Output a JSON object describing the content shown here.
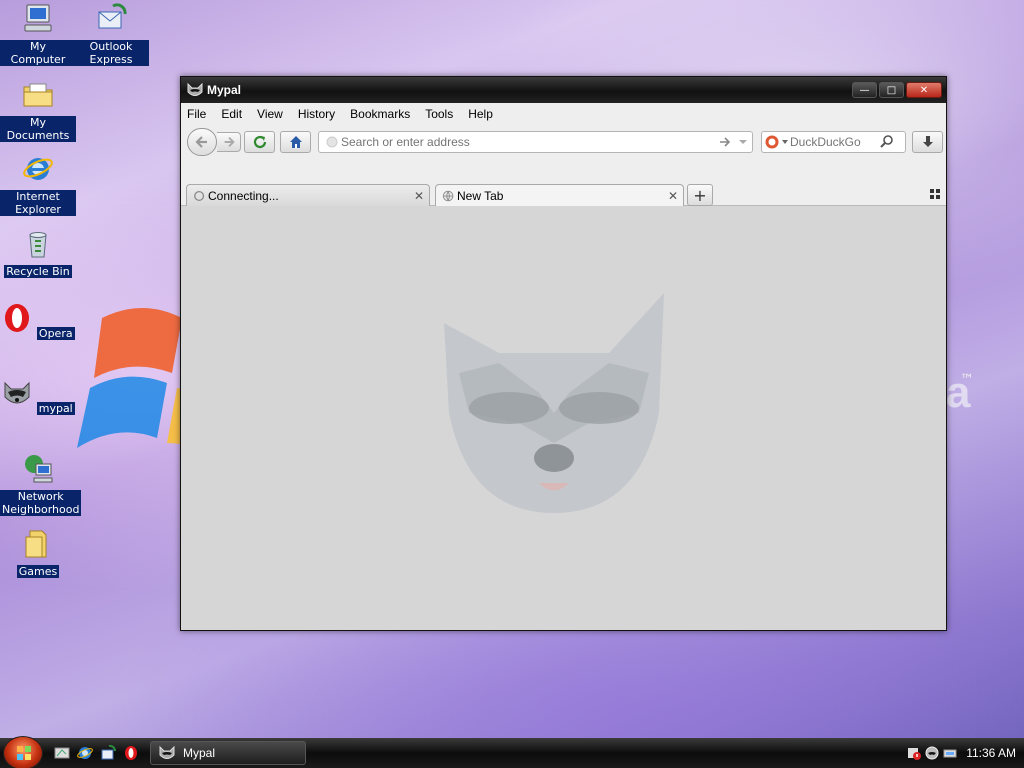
{
  "desktop": {
    "icons": [
      {
        "label": "My Computer"
      },
      {
        "label": "Outlook Express"
      },
      {
        "label": "My Documents"
      },
      {
        "label": "Internet Explorer"
      },
      {
        "label": "Recycle Bin"
      },
      {
        "label": "Opera"
      },
      {
        "label": "mypal"
      },
      {
        "label": "Network Neighborhood"
      },
      {
        "label": "Games"
      }
    ]
  },
  "window": {
    "title": "Mypal",
    "menu": [
      "File",
      "Edit",
      "View",
      "History",
      "Bookmarks",
      "Tools",
      "Help"
    ],
    "address": {
      "placeholder": "Search or enter address",
      "value": ""
    },
    "search": {
      "engine": "DuckDuckGo",
      "placeholder": "DuckDuckGo"
    },
    "tabs": [
      {
        "label": "Connecting..."
      },
      {
        "label": "New Tab"
      }
    ]
  },
  "taskbar": {
    "task_label": "Mypal",
    "clock": "11:36 AM"
  },
  "colors": {
    "selection": "#0a246a",
    "titlebar": "#111111",
    "content_bg": "#d6d6d6"
  }
}
